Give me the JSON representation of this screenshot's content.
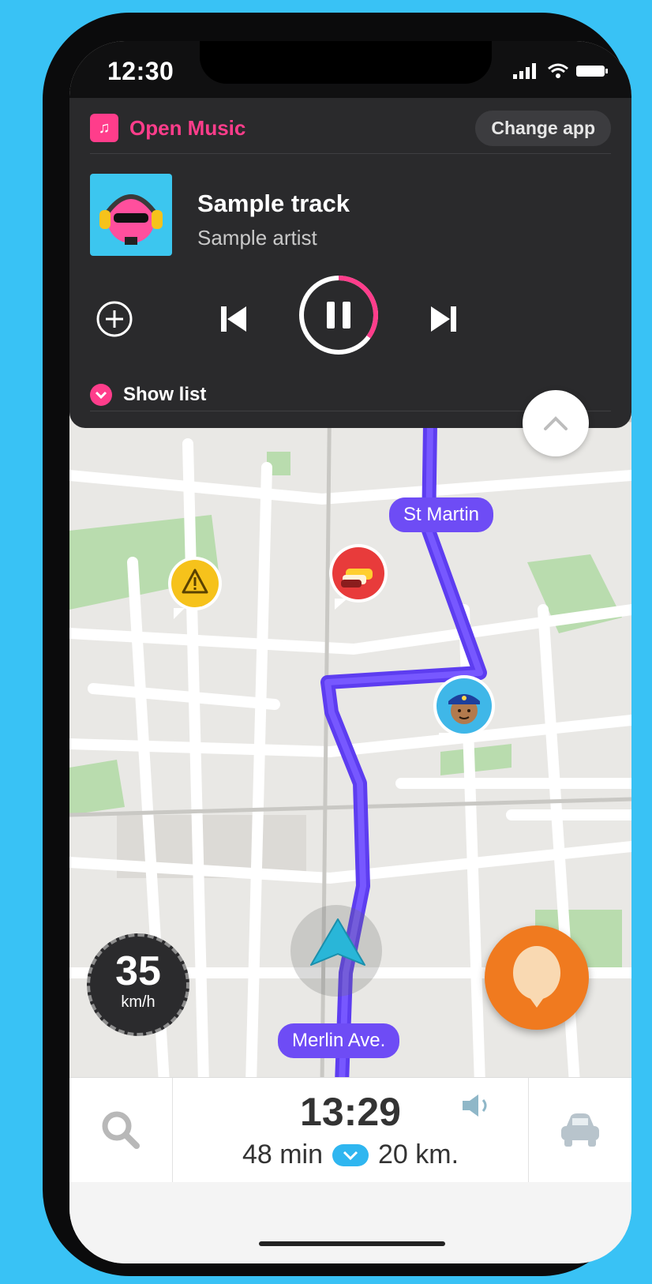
{
  "status_bar": {
    "time": "12:30"
  },
  "music": {
    "app_name": "Open Music",
    "change_app_label": "Change app",
    "track_title": "Sample track",
    "track_artist": "Sample artist",
    "show_list_label": "Show list",
    "playback_state": "playing",
    "progress_fraction": 0.35,
    "accent_color": "#ff3d8b"
  },
  "map": {
    "streets": [
      "St Martin",
      "Merlin Ave."
    ],
    "route_color": "#6e4cf5",
    "markers": [
      "hazard-icon",
      "traffic-jam-icon",
      "police-icon"
    ]
  },
  "speedometer": {
    "value": "35",
    "unit": "km/h"
  },
  "trip": {
    "arrival_time": "13:29",
    "duration": "48 min",
    "distance": "20 km."
  }
}
